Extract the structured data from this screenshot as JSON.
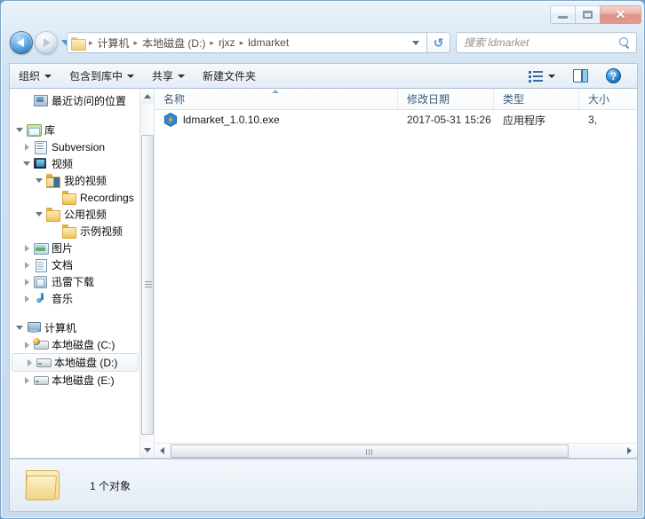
{
  "window": {
    "minimize_label": "–",
    "maximize_label": "",
    "close_label": "✕"
  },
  "address": {
    "breadcrumbs": [
      "计算机",
      "本地磁盘 (D:)",
      "rjxz",
      "ldmarket"
    ],
    "separator": "▸",
    "refresh_glyph": "↺"
  },
  "search": {
    "placeholder": "搜索 ldmarket",
    "value": ""
  },
  "toolbar": {
    "items": [
      {
        "label": "组织",
        "has_caret": true
      },
      {
        "label": "包含到库中",
        "has_caret": true
      },
      {
        "label": "共享",
        "has_caret": true
      },
      {
        "label": "新建文件夹",
        "has_caret": false
      }
    ],
    "help_label": "?"
  },
  "navpane": {
    "items": [
      {
        "label": "最近访问的位置",
        "icon": "ic-recent",
        "indent": 22,
        "twisty": "none",
        "selected": false
      },
      {
        "label": "",
        "icon": "spacer",
        "indent": 0,
        "twisty": "none",
        "selected": false,
        "spacer": true
      },
      {
        "label": "库",
        "icon": "ic-library",
        "indent": 8,
        "twisty": "expanded",
        "selected": false
      },
      {
        "label": "Subversion",
        "icon": "ic-svn",
        "indent": 22,
        "twisty": "collapsed",
        "selected": false
      },
      {
        "label": "视频",
        "icon": "ic-video",
        "indent": 22,
        "twisty": "expanded",
        "selected": false
      },
      {
        "label": "我的视频",
        "icon": "ic-videofolder",
        "indent": 36,
        "twisty": "expanded",
        "selected": false
      },
      {
        "label": "Recordings",
        "icon": "ic-folder",
        "indent": 54,
        "twisty": "none",
        "selected": false
      },
      {
        "label": "公用视频",
        "icon": "ic-folder",
        "indent": 36,
        "twisty": "expanded",
        "selected": false
      },
      {
        "label": "示例视频",
        "icon": "ic-folder",
        "indent": 54,
        "twisty": "none",
        "selected": false
      },
      {
        "label": "图片",
        "icon": "ic-picture",
        "indent": 22,
        "twisty": "collapsed",
        "selected": false
      },
      {
        "label": "文档",
        "icon": "ic-doc",
        "indent": 22,
        "twisty": "collapsed",
        "selected": false
      },
      {
        "label": "迅雷下载",
        "icon": "ic-xunlei",
        "indent": 22,
        "twisty": "collapsed",
        "selected": false
      },
      {
        "label": "音乐",
        "icon": "ic-music",
        "indent": 22,
        "twisty": "collapsed",
        "selected": false
      },
      {
        "label": "",
        "icon": "spacer",
        "indent": 0,
        "twisty": "none",
        "selected": false,
        "spacer": true
      },
      {
        "label": "计算机",
        "icon": "ic-computer",
        "indent": 8,
        "twisty": "expanded",
        "selected": false
      },
      {
        "label": "本地磁盘 (C:)",
        "icon": "ic-drive-sys",
        "indent": 22,
        "twisty": "collapsed",
        "selected": false
      },
      {
        "label": "本地磁盘 (D:)",
        "icon": "ic-drive",
        "indent": 22,
        "twisty": "collapsed",
        "selected": true
      },
      {
        "label": "本地磁盘 (E:)",
        "icon": "ic-drive",
        "indent": 22,
        "twisty": "collapsed",
        "selected": false
      }
    ]
  },
  "filelist": {
    "columns": [
      "名称",
      "修改日期",
      "类型",
      "大小"
    ],
    "sort_column": "名称",
    "sort_direction": "ascending",
    "rows": [
      {
        "name": "ldmarket_1.0.10.exe",
        "date": "2017-05-31 15:26",
        "type": "应用程序",
        "size": "3,"
      }
    ]
  },
  "statusbar": {
    "text": "1 个对象"
  },
  "colors": {
    "frame": "#cbdcee",
    "accent": "#1b6fba",
    "header_text": "#3e5977",
    "close_button": "#c2402c",
    "exe_icon": "#2f86d8",
    "exe_bolt": "#f5a623"
  }
}
